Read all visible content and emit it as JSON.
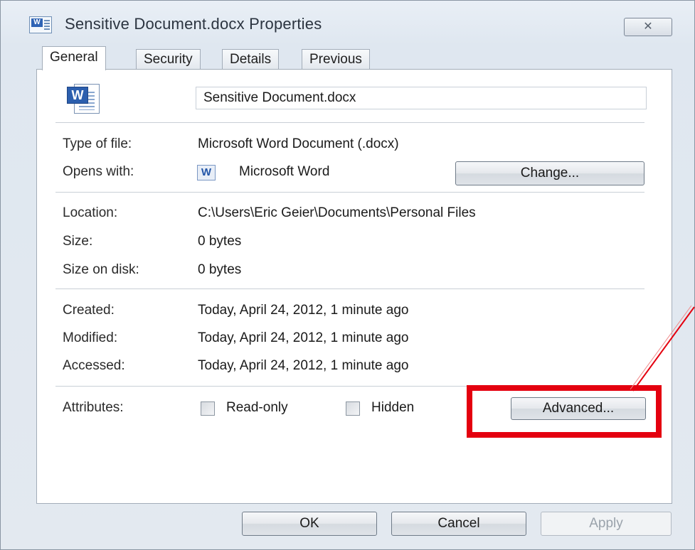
{
  "window": {
    "title": "Sensitive Document.docx Properties",
    "close_glyph": "✕"
  },
  "tabs": [
    {
      "label": "General",
      "active": true
    },
    {
      "label": "Security",
      "active": false
    },
    {
      "label": "Details",
      "active": false
    },
    {
      "label": "Previous Versions",
      "active": false
    }
  ],
  "general": {
    "file_icon": "word-document-icon",
    "filename": "Sensitive Document.docx",
    "type_label": "Type of file:",
    "type_value": "Microsoft Word Document (.docx)",
    "opens_label": "Opens with:",
    "opens_icon": "W",
    "opens_value": "Microsoft Word",
    "change_button": "Change...",
    "location_label": "Location:",
    "location_value": "C:\\Users\\Eric Geier\\Documents\\Personal Files",
    "size_label": "Size:",
    "size_value": "0 bytes",
    "size_disk_label": "Size on disk:",
    "size_disk_value": "0 bytes",
    "created_label": "Created:",
    "created_value": "Today, April 24, 2012, 1 minute ago",
    "modified_label": "Modified:",
    "modified_value": "Today, April 24, 2012, 1 minute ago",
    "accessed_label": "Accessed:",
    "accessed_value": "Today, April 24, 2012, 1 minute ago",
    "attributes_label": "Attributes:",
    "readonly_label": "Read-only",
    "hidden_label": "Hidden",
    "advanced_button": "Advanced..."
  },
  "footer": {
    "ok": "OK",
    "cancel": "Cancel",
    "apply": "Apply"
  },
  "annotation": {
    "highlight_color": "#e4000f"
  }
}
